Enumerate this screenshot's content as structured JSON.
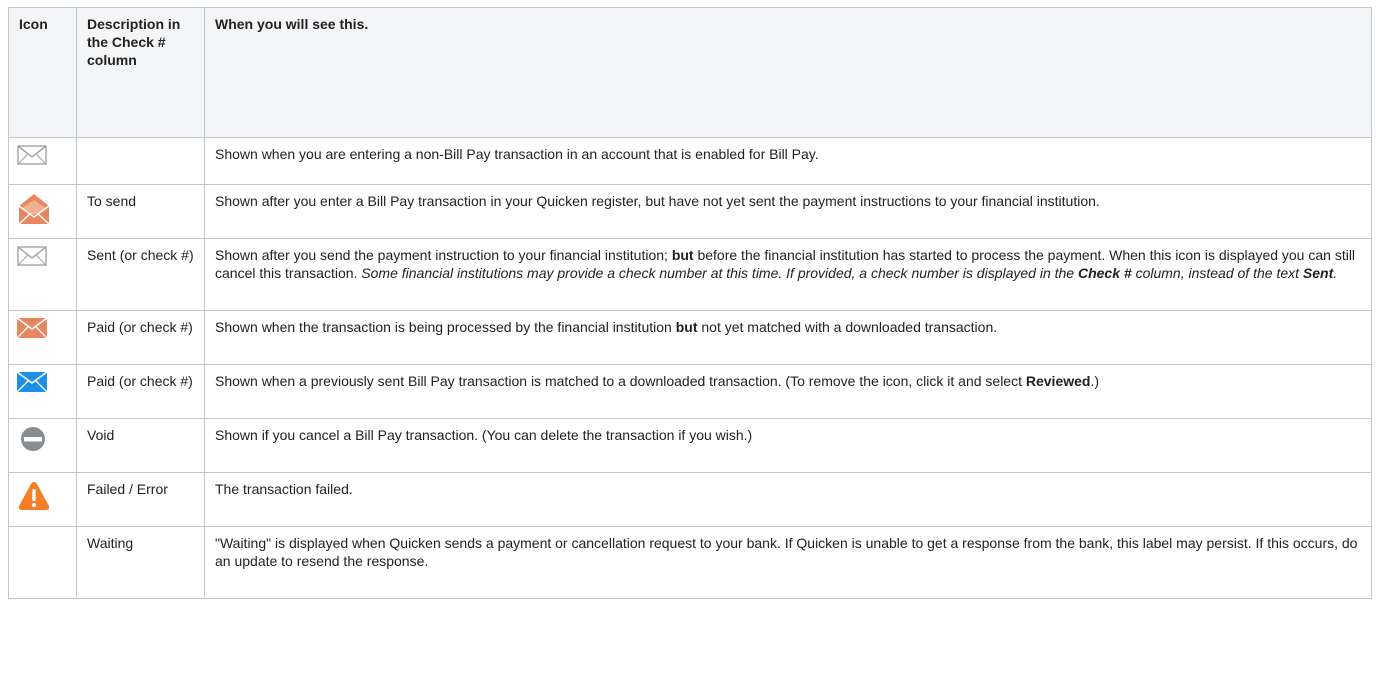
{
  "headers": {
    "icon": "Icon",
    "description": "Description in the Check # column",
    "when": "When you will see this."
  },
  "rows": [
    {
      "icon": "envelope-outline-gray-icon",
      "description": "",
      "when": "Shown when you are entering a non-Bill Pay transaction in an account that is enabled for Bill Pay."
    },
    {
      "icon": "envelope-open-orange-icon",
      "description": "To send",
      "when": "Shown after you enter a Bill Pay transaction in your Quicken register, but have not yet sent the payment instructions to your financial institution."
    },
    {
      "icon": "envelope-outline-gray-icon",
      "description": "Sent (or check #)",
      "when_parts": {
        "a": "Shown after you send the payment instruction to your financial institution; ",
        "b": "but",
        "c": " before the financial institution has started to process the payment. When this icon is displayed you can still cancel this transaction. ",
        "d": "Some financial institutions may provide a check number at this time. If provided, a check number is displayed in the ",
        "e": "Check #",
        "f": " column, instead of the text ",
        "g": "Sent",
        "h": "."
      }
    },
    {
      "icon": "envelope-orange-icon",
      "description": "Paid (or check #)",
      "when_parts": {
        "a": "Shown when the transaction is being processed by the financial institution ",
        "b": "but",
        "c": " not yet matched with a downloaded transaction."
      }
    },
    {
      "icon": "envelope-blue-icon",
      "description": "Paid (or check #)",
      "when_parts": {
        "a": "Shown when a previously sent Bill Pay transaction is matched to a downloaded transaction. (To remove the icon, click it and select ",
        "b": "Reviewed",
        "c": ".)"
      }
    },
    {
      "icon": "void-circle-icon",
      "description": "Void",
      "when": "Shown if you cancel a Bill Pay transaction. (You can delete the transaction if you wish.)"
    },
    {
      "icon": "warning-triangle-icon",
      "description": "Failed / Error",
      "when": "The transaction failed."
    },
    {
      "icon": "",
      "description": "Waiting",
      "when": "\"Waiting\" is displayed when Quicken sends a payment or cancellation request to your bank. If Quicken is unable to get a response from the bank, this label may persist. If this occurs, do an update to resend the response."
    }
  ],
  "colors": {
    "header_bg": "#f4f5f7",
    "border": "#c1c7d0",
    "orange": "#e8875f",
    "blue": "#1e90e8",
    "gray_outline": "#a9a9a9",
    "void_gray": "#8a8d90",
    "warning_orange": "#f57f28"
  }
}
